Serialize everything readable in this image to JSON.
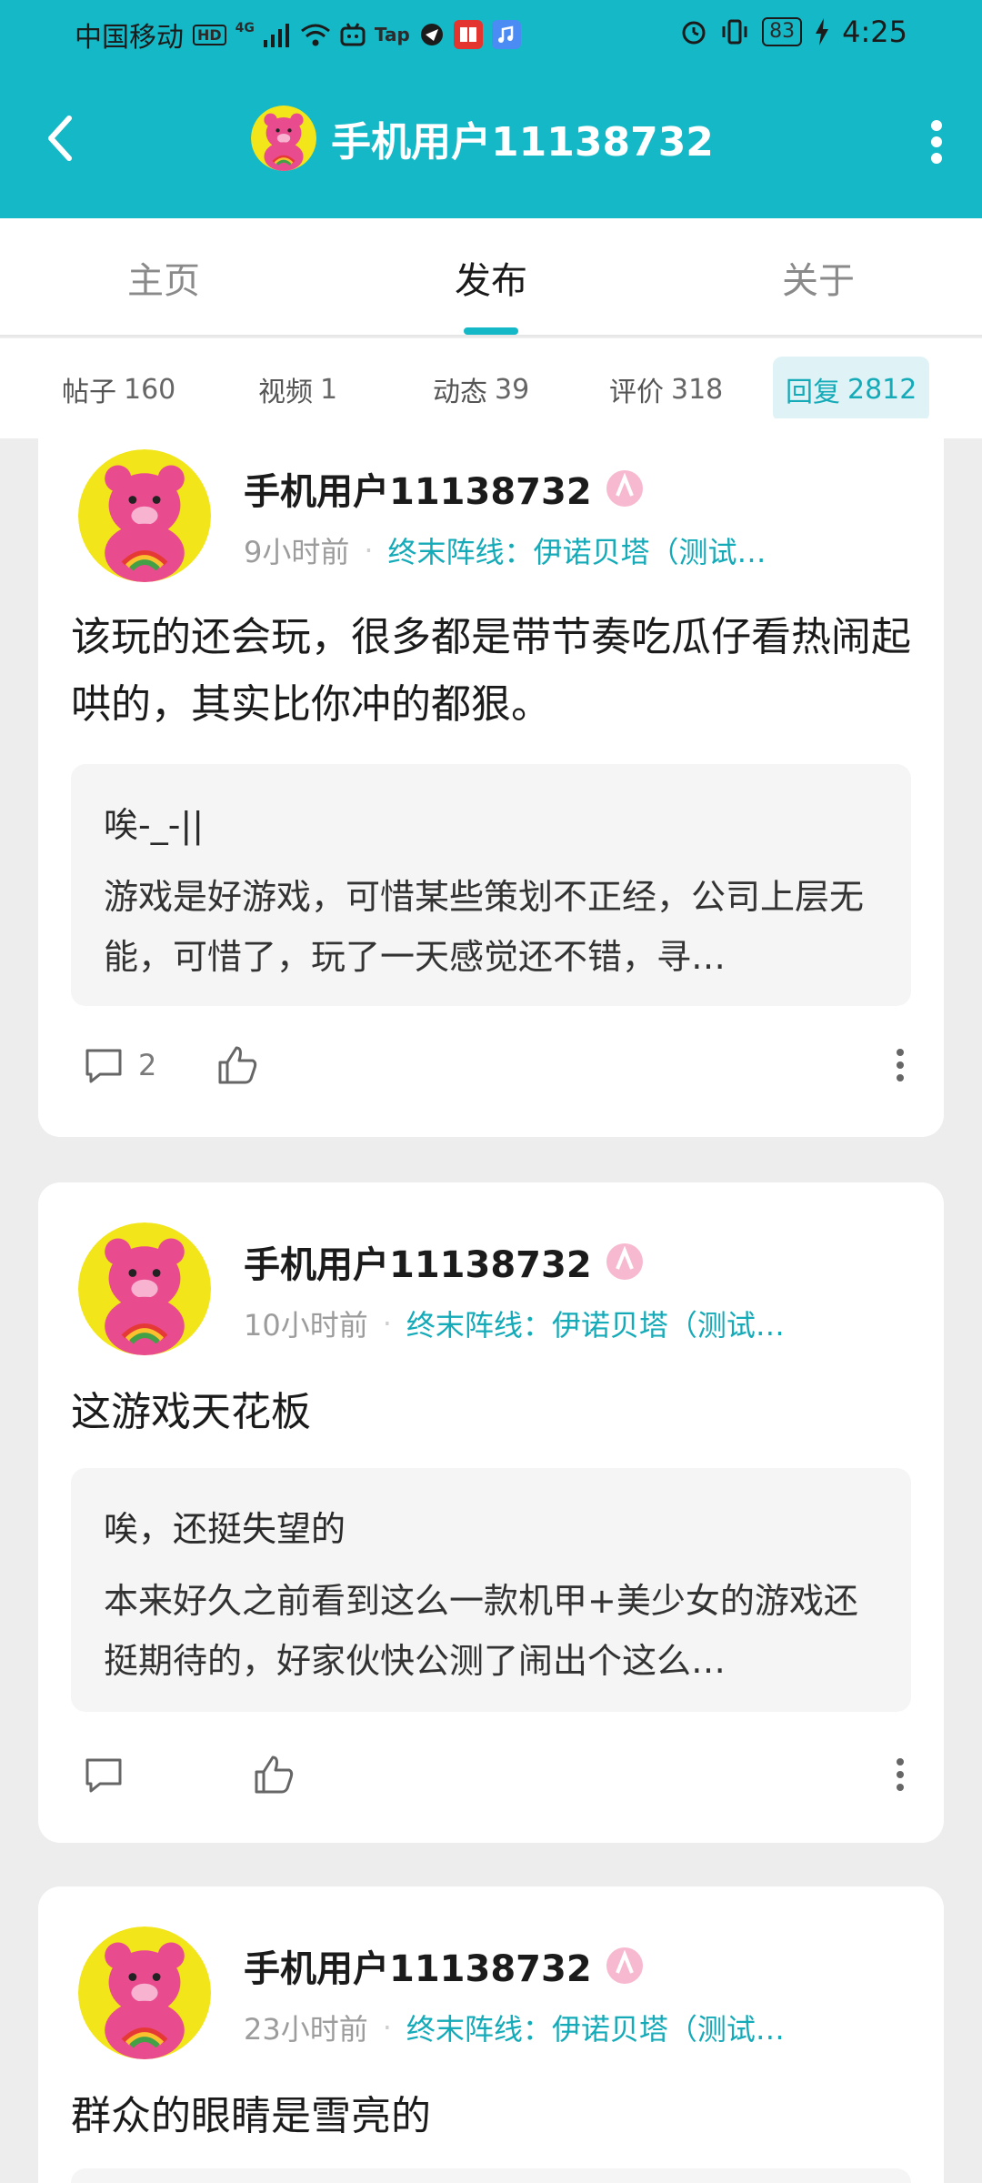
{
  "status": {
    "carrier": "中国移动",
    "hd_badge": "HD",
    "net_badge": "4G",
    "tap_badge": "Tap",
    "battery": "83",
    "time": "4:25"
  },
  "header": {
    "title": "手机用户11138732"
  },
  "tabs": [
    {
      "label": "主页"
    },
    {
      "label": "发布"
    },
    {
      "label": "关于"
    }
  ],
  "filters": [
    {
      "label": "帖子",
      "count": "160"
    },
    {
      "label": "视频",
      "count": "1"
    },
    {
      "label": "动态",
      "count": "39"
    },
    {
      "label": "评价",
      "count": "318"
    },
    {
      "label": "回复",
      "count": "2812"
    }
  ],
  "posts": [
    {
      "user": "手机用户11138732",
      "time": "9小时前",
      "game": "终末阵线：伊诺贝塔（测试…",
      "content": "该玩的还会玩，很多都是带节奏吃瓜仔看热闹起哄的，其实比你冲的都狠。",
      "quote_title": "唉-_-||",
      "quote_body": "游戏是好游戏，可惜某些策划不正经，公司上层无能，可惜了，玩了一天感觉还不错，寻…",
      "comments": "2"
    },
    {
      "user": "手机用户11138732",
      "time": "10小时前",
      "game": "终末阵线：伊诺贝塔（测试…",
      "content": "这游戏天花板",
      "quote_title": "唉，还挺失望的",
      "quote_body": "本来好久之前看到这么一款机甲+美少女的游戏还挺期待的，好家伙快公测了闹出个这么…",
      "comments": ""
    },
    {
      "user": "手机用户11138732",
      "time": "23小时前",
      "game": "终末阵线：伊诺贝塔（测试…",
      "content": "群众的眼睛是雪亮的"
    }
  ],
  "colors": {
    "accent": "#15b8c6",
    "accent_text": "#15aab8",
    "avatar_bg": "#f2e51a",
    "bear_pink": "#e94b8f"
  },
  "icons": {
    "back": "back-arrow-icon",
    "more": "more-vertical-icon",
    "comment": "comment-icon",
    "like": "thumbs-up-icon",
    "badge": "user-badge-icon"
  }
}
